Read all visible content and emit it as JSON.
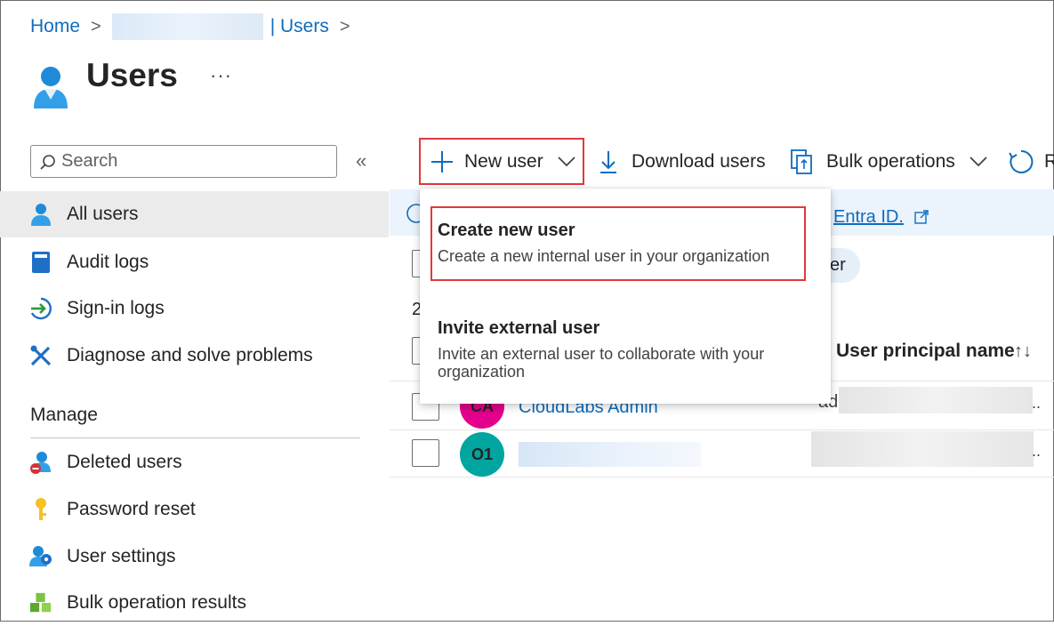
{
  "breadcrumb": {
    "home": "Home",
    "separator": ">",
    "users": "| Users"
  },
  "header": {
    "title": "Users",
    "more": "···"
  },
  "search": {
    "placeholder": "Search"
  },
  "nav": {
    "collapse": "«",
    "items": [
      {
        "label": "All users",
        "icon": "user-icon"
      },
      {
        "label": "Audit logs",
        "icon": "log-book-icon"
      },
      {
        "label": "Sign-in logs",
        "icon": "sign-in-arrow-icon"
      },
      {
        "label": "Diagnose and solve problems",
        "icon": "wrench-icon"
      }
    ],
    "manage_title": "Manage",
    "manage_items": [
      {
        "label": "Deleted users",
        "icon": "deleted-user-icon"
      },
      {
        "label": "Password reset",
        "icon": "key-icon"
      },
      {
        "label": "User settings",
        "icon": "user-settings-icon"
      },
      {
        "label": "Bulk operation results",
        "icon": "cubes-icon"
      }
    ]
  },
  "toolbar": {
    "new_user": "New user",
    "download_users": "Download users",
    "bulk_operations": "Bulk operations",
    "refresh_fragment": "R"
  },
  "banner": {
    "link_text": "Entra ID."
  },
  "filter": {
    "pill_fragment": "er"
  },
  "count_fragment": "2",
  "table": {
    "column_upn": "User principal name",
    "sort_symbol": "↑↓",
    "rows": [
      {
        "initials": "CA",
        "name": "CloudLabs Admin",
        "upn_fragment": "ad",
        "avatar_color": "#e3008c"
      },
      {
        "initials": "O1",
        "name": "",
        "upn_fragment": "",
        "avatar_color": "#00a5a0"
      }
    ],
    "ellipsis": ".."
  },
  "dropdown": {
    "items": [
      {
        "title": "Create new user",
        "description": "Create a new internal user in your organization"
      },
      {
        "title": "Invite external user",
        "description": "Invite an external user to collaborate with your organization"
      }
    ]
  },
  "colors": {
    "accent": "#0f6cbd",
    "highlight": "#e0383e"
  }
}
